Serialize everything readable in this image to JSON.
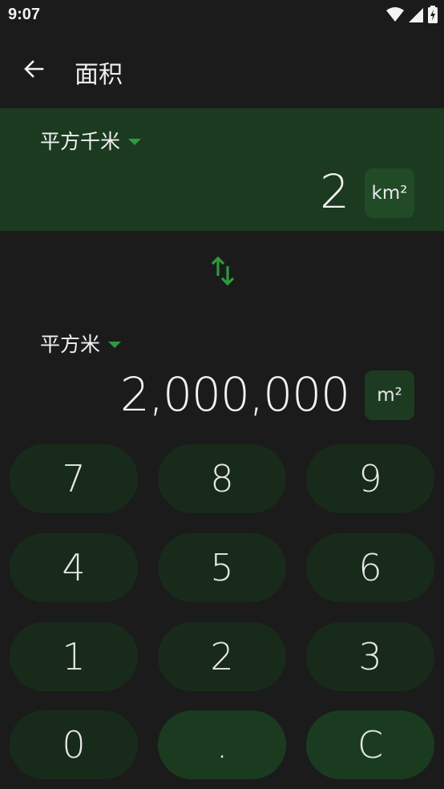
{
  "status_bar": {
    "time": "9:07"
  },
  "app_bar": {
    "title": "面积"
  },
  "from_unit": {
    "name": "平方千米",
    "value": "2",
    "symbol": "km²"
  },
  "to_unit": {
    "name": "平方米",
    "value": "2,000,000",
    "symbol": "m²"
  },
  "keypad": {
    "keys": [
      "7",
      "8",
      "9",
      "4",
      "5",
      "6",
      "1",
      "2",
      "3",
      "0",
      ".",
      "C"
    ]
  },
  "colors": {
    "background": "#1b1b1b",
    "active_panel": "#1b3a1f",
    "accent_green": "#2e9a3d",
    "key_bg": "#182b1b",
    "accent_key_bg": "#1a3b1f"
  },
  "icons": {
    "back": "arrow-left-icon",
    "swap": "swap-vertical-icon",
    "dropdown": "caret-down-icon",
    "wifi": "wifi-icon",
    "signal": "signal-icon",
    "battery": "battery-icon"
  }
}
